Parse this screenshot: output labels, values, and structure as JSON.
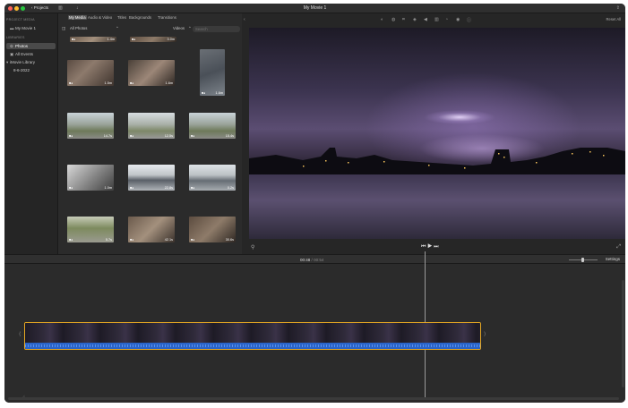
{
  "titlebar": {
    "projects_label": "‹ Projects",
    "title": "My Movie 1"
  },
  "sidebar": {
    "project_media_heading": "PROJECT MEDIA",
    "project_item": "My Movie 1",
    "libraries_heading": "LIBRARIES",
    "items": [
      {
        "label": "Photos",
        "icon": "photos-icon"
      },
      {
        "label": "All Events",
        "icon": "events-icon"
      },
      {
        "label": "iMovie Library",
        "icon": "library-icon"
      },
      {
        "label": "8-6-2022",
        "icon": ""
      }
    ]
  },
  "browser": {
    "tabs": [
      "My Media",
      "Audio & Video",
      "Titles",
      "Backgrounds",
      "Transitions"
    ],
    "album": "All Photos",
    "filter": "Videos",
    "search_placeholder": "Search",
    "thumbnails": [
      {
        "duration": "1.4m"
      },
      {
        "duration": "3.0m"
      },
      {
        "duration": "1.6m"
      },
      {
        "duration": "1.5m"
      },
      {
        "duration": "1.6m"
      },
      {
        "duration": "14.7s"
      },
      {
        "duration": "12.5s"
      },
      {
        "duration": "15.4s"
      },
      {
        "duration": "1.0m"
      },
      {
        "duration": "22.8s"
      },
      {
        "duration": "0.2s"
      },
      {
        "duration": "5.7s"
      },
      {
        "duration": "42.1s"
      },
      {
        "duration": "30.6s"
      }
    ]
  },
  "viewer": {
    "reset_all": "Reset All"
  },
  "timeline": {
    "current_time": "00:48",
    "separator": "/",
    "total_time": "00:54",
    "settings_label": "Settings"
  },
  "colors": {
    "clip_border": "#e5a723",
    "audio_track": "#2a64c8"
  }
}
